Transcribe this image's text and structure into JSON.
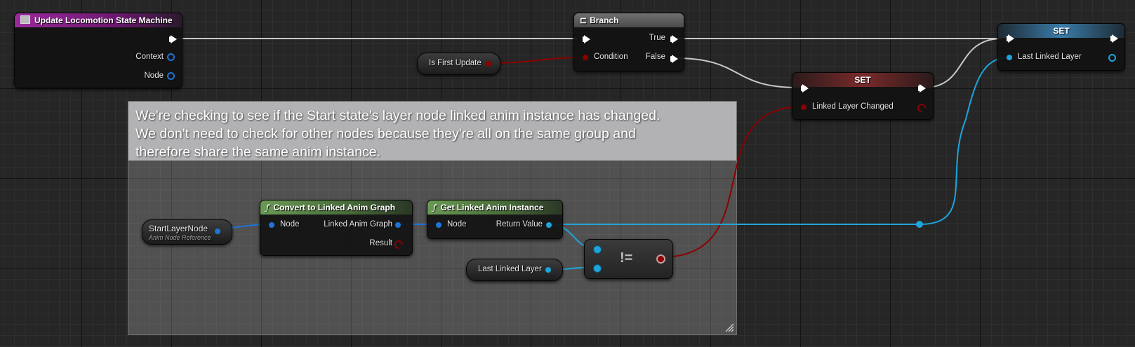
{
  "colors": {
    "exec": "#ffffff",
    "bool_pin": "#8c0000",
    "object_pin": "#1e74d8",
    "anim_instance_pin": "#1ea4dc",
    "event_header": "#8d1e8f",
    "pure_function_header": "#5d8a47",
    "branch_header": "#5a5a5a",
    "set_header": "#2d4f6b",
    "set_header_red": "#6b2323"
  },
  "event_node": {
    "icon": "event-icon",
    "title": "Update Locomotion State Machine",
    "pins": [
      "Context",
      "Node"
    ]
  },
  "branch_node": {
    "icon": "branch-icon",
    "title": "Branch",
    "condition_label": "Condition",
    "true_label": "True",
    "false_label": "False"
  },
  "is_first_update": {
    "label": "Is First Update"
  },
  "set_linked_layer_changed": {
    "title": "SET",
    "pin_label": "Linked Layer Changed"
  },
  "set_last_linked_layer": {
    "title": "SET",
    "pin_label": "Last Linked Layer"
  },
  "comment": {
    "lines": [
      "We're checking to see if the Start state's layer node linked anim instance has changed.",
      "We don't need to check for other nodes because they're all on the same group and",
      "therefore share the same anim instance."
    ]
  },
  "start_layer_node": {
    "label": "StartLayerNode",
    "sublabel": "Anim Node Reference"
  },
  "convert_node": {
    "icon": "function-icon",
    "title": "Convert to Linked Anim Graph",
    "input_label": "Node",
    "output_label": "Linked Anim Graph",
    "result_label": "Result"
  },
  "get_instance_node": {
    "icon": "function-icon",
    "title": "Get Linked Anim Instance",
    "input_label": "Node",
    "output_label": "Return Value"
  },
  "last_linked_layer_getter": {
    "label": "Last Linked Layer"
  },
  "not_equal_node": {
    "symbol": "!="
  }
}
